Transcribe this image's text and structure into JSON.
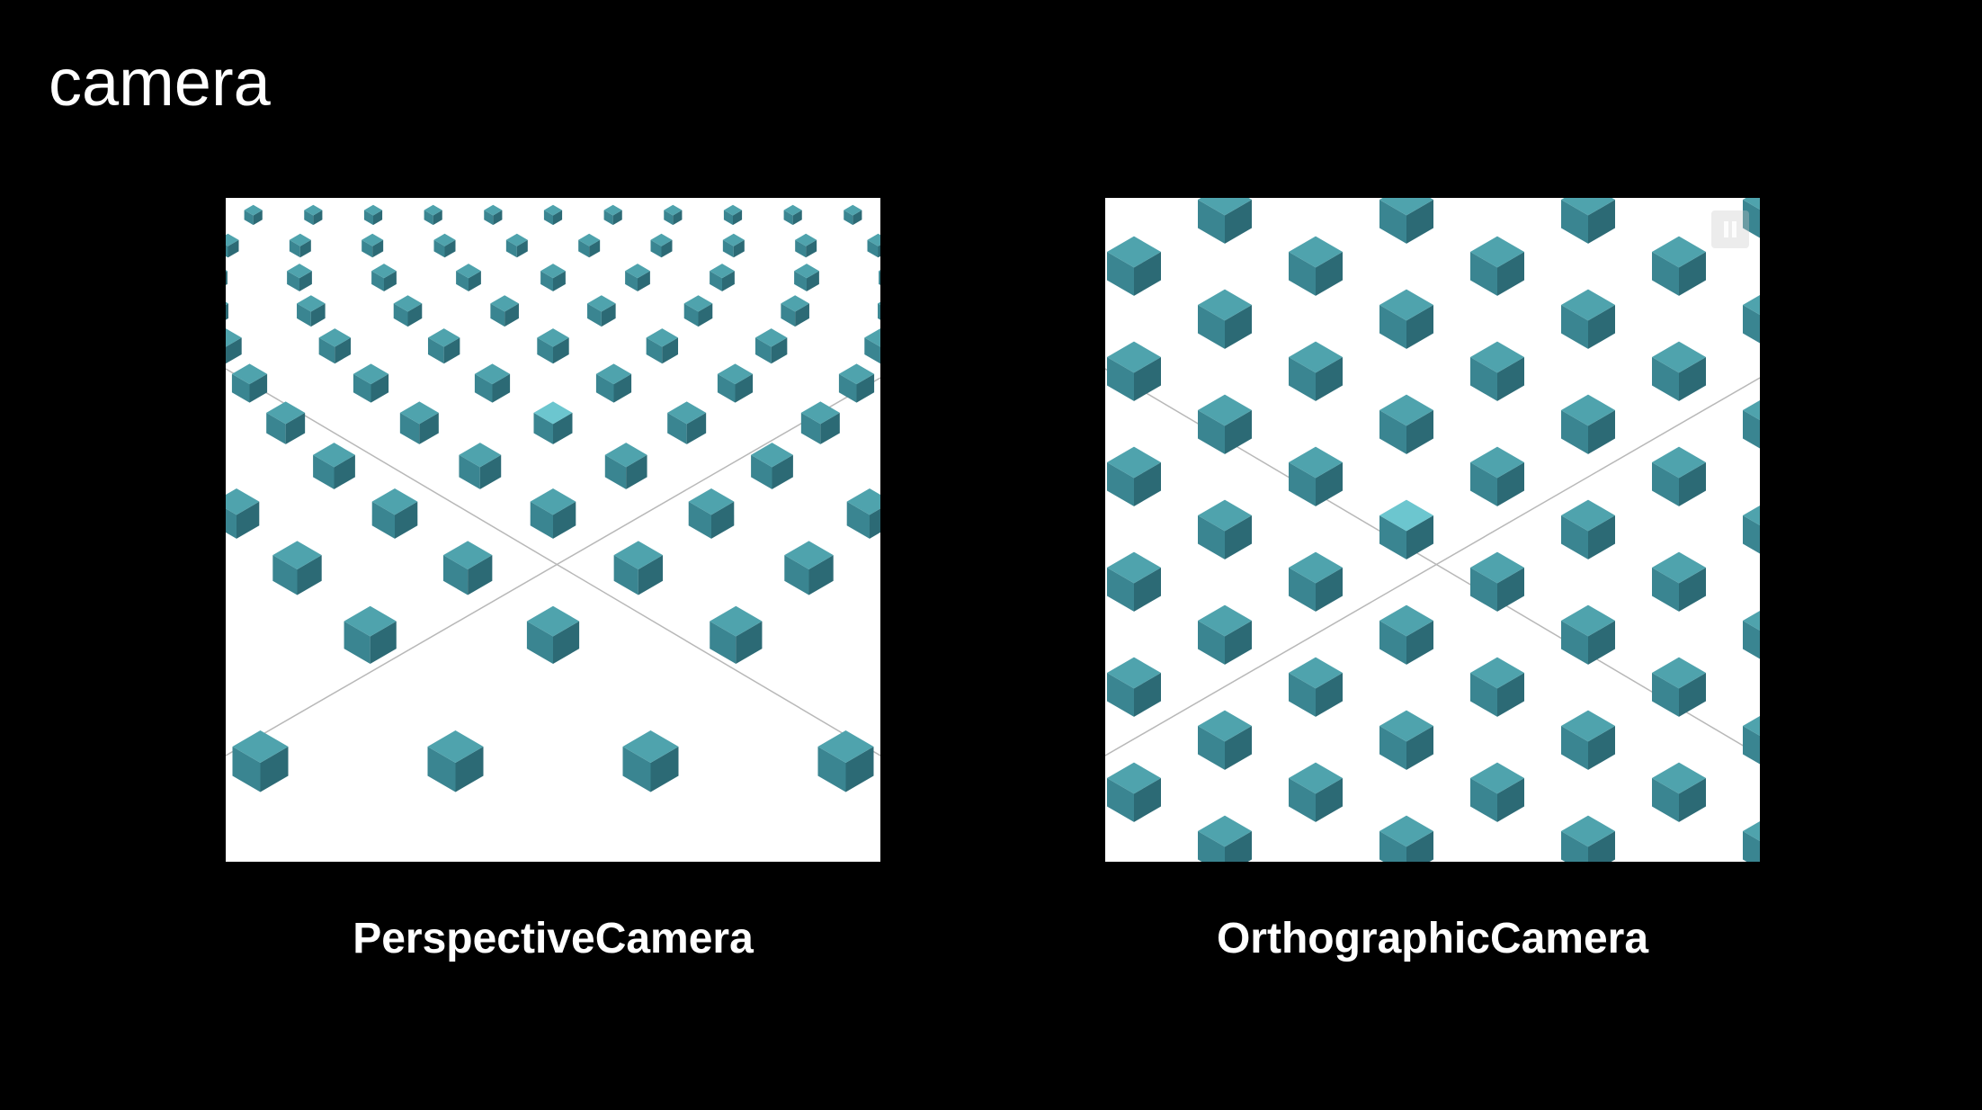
{
  "slide": {
    "title": "camera"
  },
  "panels": [
    {
      "caption": "PerspectiveCamera"
    },
    {
      "caption": "OrthographicCamera"
    }
  ],
  "colors": {
    "background": "#000000",
    "canvas": "#ffffff",
    "cube_top": "#4fa3ad",
    "cube_left": "#3a8591",
    "cube_right": "#2c6a75",
    "highlight_top": "#6cc6cf",
    "grid_line": "#b8b8b8"
  },
  "icons": {
    "pause": "pause-icon"
  }
}
